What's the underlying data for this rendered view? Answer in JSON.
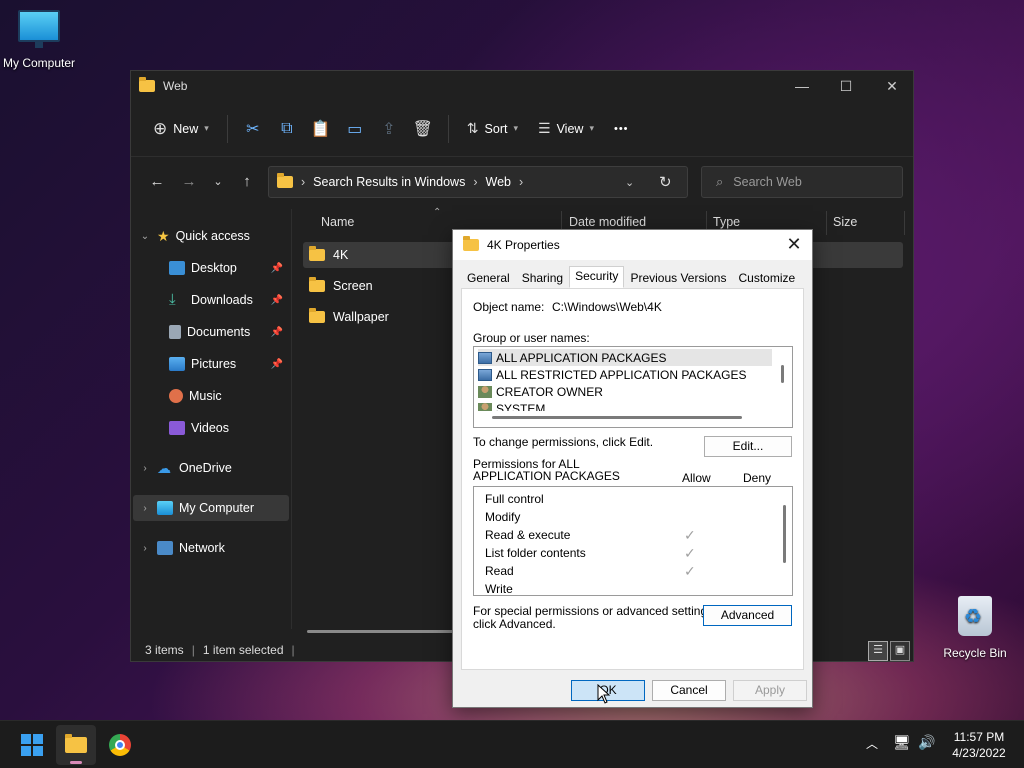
{
  "desktop": {
    "my_computer_label": "My Computer",
    "recycle_bin_label": "Recycle Bin"
  },
  "explorer": {
    "title": "Web",
    "toolbar": {
      "new_label": "New",
      "sort_label": "Sort",
      "view_label": "View",
      "more_label": "•••"
    },
    "address": {
      "crumbs": [
        "Search Results in Windows",
        "Web"
      ],
      "search_placeholder": "Search Web"
    },
    "sidebar": {
      "quick_access": "Quick access",
      "items": [
        "Desktop",
        "Downloads",
        "Documents",
        "Pictures",
        "Music",
        "Videos"
      ],
      "onedrive": "OneDrive",
      "my_computer": "My Computer",
      "network": "Network"
    },
    "columns": [
      "Name",
      "Date modified",
      "Type",
      "Size"
    ],
    "files": [
      "4K",
      "Screen",
      "Wallpaper"
    ],
    "status": {
      "count": "3 items",
      "selected": "1 item selected"
    }
  },
  "dialog": {
    "title": "4K Properties",
    "tabs": [
      "General",
      "Sharing",
      "Security",
      "Previous Versions",
      "Customize"
    ],
    "active_tab": "Security",
    "object_name_label": "Object name:",
    "object_name_value": "C:\\Windows\\Web\\4K",
    "group_label": "Group or user names:",
    "groups": [
      "ALL APPLICATION PACKAGES",
      "ALL RESTRICTED APPLICATION PACKAGES",
      "CREATOR OWNER",
      "SYSTEM"
    ],
    "change_text": "To change permissions, click Edit.",
    "edit_label": "Edit...",
    "permissions_for_line1": "Permissions for ALL",
    "permissions_for_line2": "APPLICATION PACKAGES",
    "allow_label": "Allow",
    "deny_label": "Deny",
    "permissions": [
      {
        "name": "Full control",
        "allow": false
      },
      {
        "name": "Modify",
        "allow": false
      },
      {
        "name": "Read & execute",
        "allow": true
      },
      {
        "name": "List folder contents",
        "allow": true
      },
      {
        "name": "Read",
        "allow": true
      },
      {
        "name": "Write",
        "allow": false
      }
    ],
    "special_line1": "For special permissions or advanced settings,",
    "special_line2": "click Advanced.",
    "advanced_label": "Advanced",
    "ok_label": "OK",
    "cancel_label": "Cancel",
    "apply_label": "Apply",
    "check_glyph": "✓"
  },
  "taskbar": {
    "time": "11:57 PM",
    "date": "4/23/2022"
  }
}
